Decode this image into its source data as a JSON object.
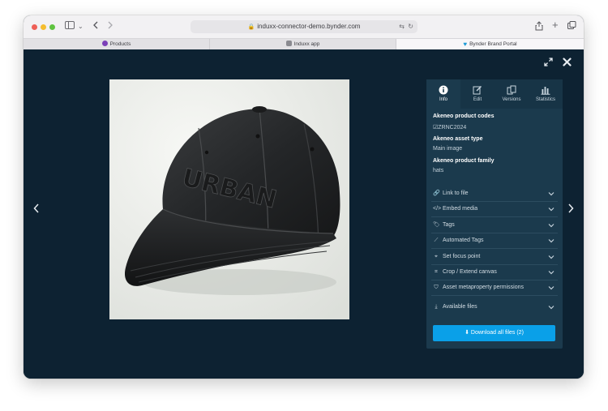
{
  "browser": {
    "url": "induxx-connector-demo.bynder.com",
    "tabs": [
      {
        "label": "Products"
      },
      {
        "label": "Induxx app"
      },
      {
        "label": "Bynder Brand Portal"
      }
    ]
  },
  "viewer": {
    "image_alt": "Black baseball cap with embossed URBAN lettering",
    "cap_text": "URBAN"
  },
  "panel": {
    "tabs": [
      {
        "label": "Info",
        "icon": "info-icon"
      },
      {
        "label": "Edit",
        "icon": "edit-icon"
      },
      {
        "label": "Versions",
        "icon": "versions-icon"
      },
      {
        "label": "Statistics",
        "icon": "statistics-icon"
      }
    ],
    "metadata": [
      {
        "title": "Akeneo product codes",
        "value": "ZRNC2024"
      },
      {
        "title": "Akeneo asset type",
        "value": "Main image"
      },
      {
        "title": "Akeneo product family",
        "value": "hats"
      }
    ],
    "sections": [
      {
        "label": "Link to file",
        "icon": "link-icon"
      },
      {
        "label": "Embed media",
        "icon": "code-icon"
      },
      {
        "label": "Tags",
        "icon": "tag-icon"
      },
      {
        "label": "Automated Tags",
        "icon": "wand-icon"
      },
      {
        "label": "Set focus point",
        "icon": "focus-icon"
      },
      {
        "label": "Crop / Extend canvas",
        "icon": "crop-icon"
      },
      {
        "label": "Asset metaproperty permissions",
        "icon": "shield-icon"
      },
      {
        "label": "Available files",
        "icon": "download-icon"
      }
    ],
    "download_label": "Download all files (2)"
  },
  "colors": {
    "background": "#0d2232",
    "panel": "#1b3a4d",
    "accent": "#0aa0e8"
  }
}
